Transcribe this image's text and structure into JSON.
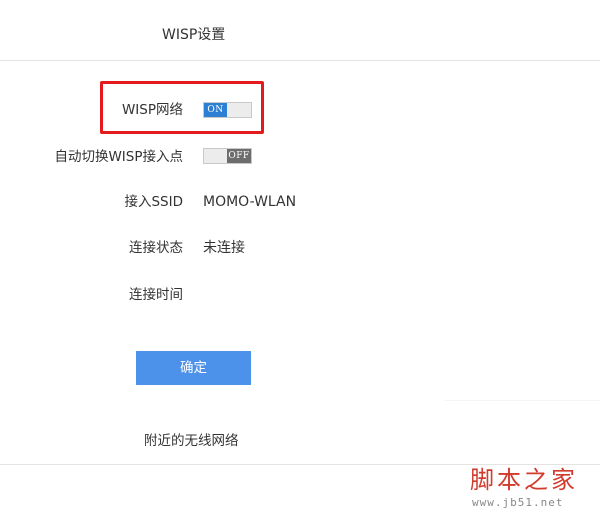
{
  "header": {
    "title": "WISP设置"
  },
  "wisp_network": {
    "label": "WISP网络",
    "toggle_text": "ON",
    "state": "on"
  },
  "auto_switch": {
    "label": "自动切换WISP接入点",
    "toggle_text": "OFF",
    "state": "off"
  },
  "ssid": {
    "label": "接入SSID",
    "value": "MOMO-WLAN"
  },
  "connection_status": {
    "label": "连接状态",
    "value": "未连接"
  },
  "connection_time": {
    "label": "连接时间",
    "value": ""
  },
  "confirm_button": {
    "label": "确定"
  },
  "nearby_networks": {
    "label": "附近的无线网络"
  },
  "watermark": {
    "text": "脚本之家",
    "url": "www.jb51.net"
  },
  "colors": {
    "accent_blue": "#4c91ea",
    "toggle_on_blue": "#2d7fd3",
    "toggle_off_gray": "#6d6d6d",
    "highlight_red": "#e41a1c",
    "watermark_red": "#d23a2c"
  }
}
